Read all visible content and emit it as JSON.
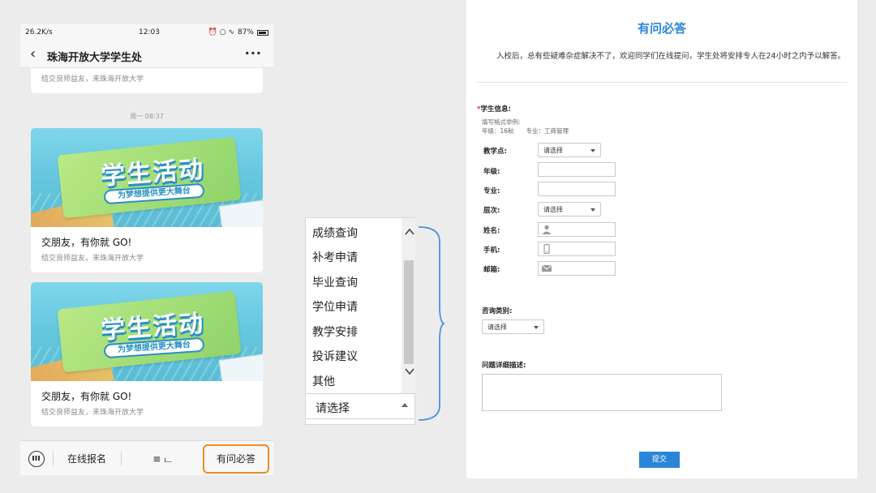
{
  "phone": {
    "status": {
      "signal": "*©\u0000",
      "speed": "26.2K/s",
      "time": "12:03",
      "right_icons": "⏰ ○ ∿",
      "battery": "87%"
    },
    "nav": {
      "back": "‹",
      "title": "珠海开放大学学生处",
      "more": "···"
    },
    "top_card_sub": "结交良师益友，来珠海开放大学",
    "timestamp": "周一 08:37",
    "articles": [
      {
        "banner_title": "学生活动",
        "banner_pill": "为梦想提供更大舞台",
        "title": "交朋友，有你就 GO!",
        "sub": "结交良师益友，来珠海开放大学"
      },
      {
        "banner_title": "学生活动",
        "banner_pill": "为梦想提供更大舞台",
        "title": "交朋友，有你就 GO!",
        "sub": "结交良师益友，来珠海开放大学"
      }
    ],
    "tabs": {
      "online_signup": "在线报名",
      "menu": "≡ ட",
      "faq": "有问必答"
    }
  },
  "dropdown": {
    "options": [
      "成绩查询",
      "补考申请",
      "毕业查询",
      "学位申请",
      "教学安排",
      "投诉建议",
      "其他"
    ],
    "selected": "请选择"
  },
  "form": {
    "title": "有问必答",
    "intro": "入校后，总有些疑难杂症解决不了，欢迎同学们在线提问，学生处将安排专人在24小时之内予以解答。",
    "student_info_label": "学生信息:",
    "required_mark": "*",
    "hint_line1": "填写格式举例:",
    "hint_line2": "年级：16秋　　专业：工商管理",
    "fields": {
      "campus": "教学点:",
      "grade": "年级:",
      "major": "专业:",
      "level": "层次:",
      "name": "姓名:",
      "phone": "手机:",
      "email": "邮箱:"
    },
    "select_placeholder": "请选择",
    "category_label": "咨询类别:",
    "detail_label": "问题详细描述:",
    "submit": "提交"
  }
}
